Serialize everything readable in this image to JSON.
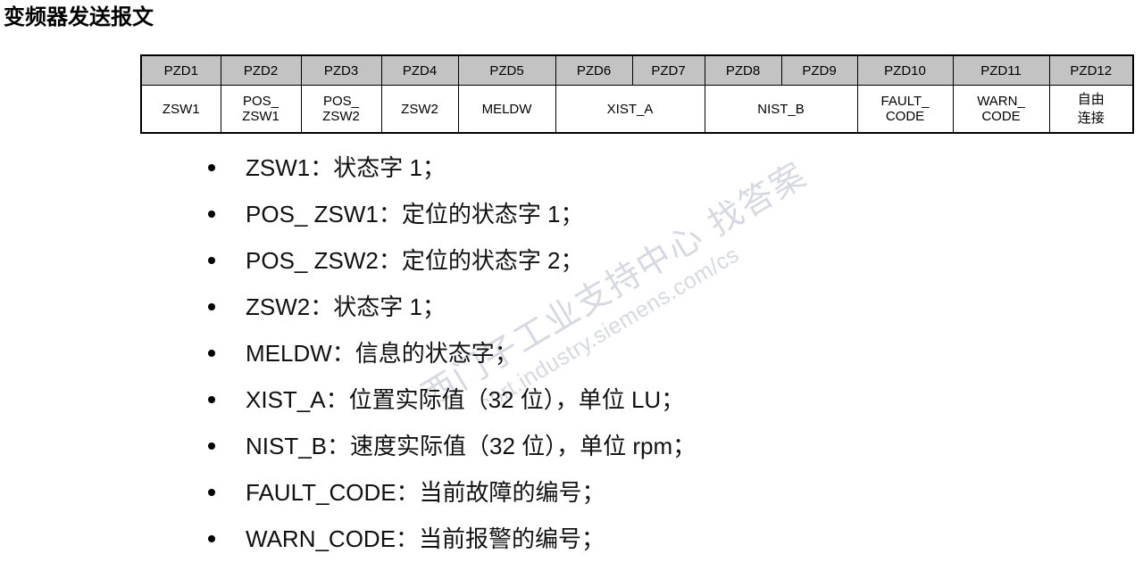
{
  "title": "变频器发送报文",
  "watermark": {
    "line1": "西门子工业支持中心 找答案",
    "line2": "support.industry.siemens.com/cs"
  },
  "table": {
    "header_row": [
      "PZD1",
      "PZD2",
      "PZD3",
      "PZD4",
      "PZD5",
      "PZD6",
      "PZD7",
      "PZD8",
      "PZD9",
      "PZD10",
      "PZD11",
      "PZD12"
    ],
    "body_cells": [
      {
        "text": "ZSW1",
        "span": 1
      },
      {
        "text": "POS_\nZSW1",
        "span": 1
      },
      {
        "text": "POS_\nZSW2",
        "span": 1
      },
      {
        "text": "ZSW2",
        "span": 1
      },
      {
        "text": "MELDW",
        "span": 1
      },
      {
        "text": "XIST_A",
        "span": 2
      },
      {
        "text": "NIST_B",
        "span": 2
      },
      {
        "text": "FAULT_\nCODE",
        "span": 1
      },
      {
        "text": "WARN_\nCODE",
        "span": 1
      },
      {
        "text": "自由\n连接",
        "span": 1
      }
    ],
    "body_line_pairs": {
      "pzd2_line1": "POS_",
      "pzd2_line2": "ZSW1",
      "pzd3_line1": "POS_",
      "pzd3_line2": "ZSW2",
      "pzd10_line1": "FAULT_",
      "pzd10_line2": "CODE",
      "pzd11_line1": "WARN_",
      "pzd11_line2": "CODE",
      "pzd12_line1": "自由",
      "pzd12_line2": "连接"
    },
    "pzd1": "ZSW1",
    "pzd4": "ZSW2",
    "pzd5": "MELDW",
    "pzd6_7": "XIST_A",
    "pzd8_9": "NIST_B",
    "header_bg": "#c3c3c3",
    "border_color": "#000000"
  },
  "bullets": [
    {
      "text": "ZSW1：状态字 1；"
    },
    {
      "text": "POS_ ZSW1：定位的状态字 1；"
    },
    {
      "text": "POS_ ZSW2：定位的状态字 2；"
    },
    {
      "text": "ZSW2：状态字 1；"
    },
    {
      "text": "MELDW：信息的状态字；"
    },
    {
      "text": "XIST_A：位置实际值（32 位），单位 LU；"
    },
    {
      "text": "NIST_B：速度实际值（32 位），单位 rpm；"
    },
    {
      "text": "FAULT_CODE：当前故障的编号；"
    },
    {
      "text": "WARN_CODE：当前报警的编号；"
    }
  ]
}
